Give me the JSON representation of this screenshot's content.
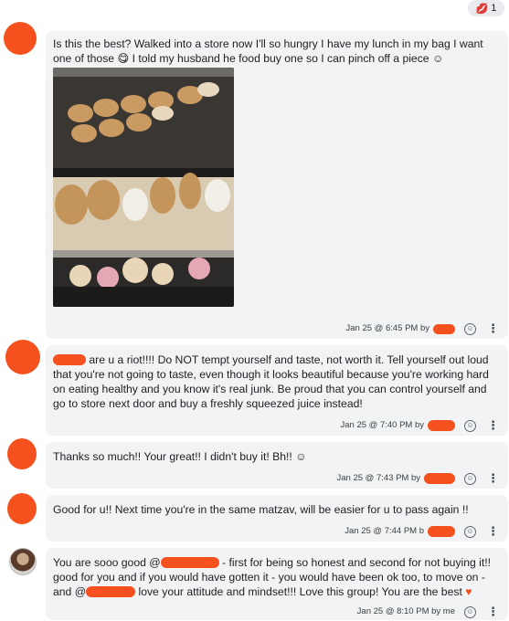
{
  "reaction": {
    "emoji": "💋",
    "count": "1"
  },
  "messages": [
    {
      "text_before": "Is this  the best? Walked into a store now I'll so hungry I have my lunch in my bag I want one of those ",
      "emoji1": "😋",
      "text_after": " I told my husband he food buy one so I can pinch off a piece ☺",
      "timestamp": "Jan 25 @ 6:45 PM by",
      "image_alt": "bakery display case with donuts and pastries"
    },
    {
      "text_lead": "are u a riot!!!! Do NOT tempt yourself and taste, not worth it. Tell yourself out loud that you're not going to taste, even though it looks beautiful because you're working hard on eating healthy and you know it's real junk. Be proud that you can control yourself and go to store next door and buy a freshly squeezed juice instead!",
      "timestamp": "Jan 25 @ 7:40 PM by"
    },
    {
      "text": "Thanks so much!! Your great!! I didn't buy it! Bh!! ☺",
      "timestamp": "Jan 25 @ 7:43 PM by"
    },
    {
      "text": "Good for u!! Next time you're in the same matzav, will be easier for u to pass again !!",
      "timestamp": "Jan 25 @ 7:44 PM b"
    },
    {
      "text_part1": "You are sooo good @",
      "text_part2": " - first for being so honest and second for not buying it!! good for you and if you would have gotten it - you would have been ok too, to move on  - and @",
      "text_part3": " love your attitude and mindset!!! Love this group! You are the best ",
      "heart": "♥",
      "timestamp": "Jan 25 @ 8:10 PM by me"
    }
  ],
  "icons": {
    "react": "smiley-icon",
    "more": "more-vert-icon"
  },
  "colors": {
    "redaction": "#f4511e",
    "card_bg": "#f1f3f4",
    "heart": "#f4511e"
  }
}
